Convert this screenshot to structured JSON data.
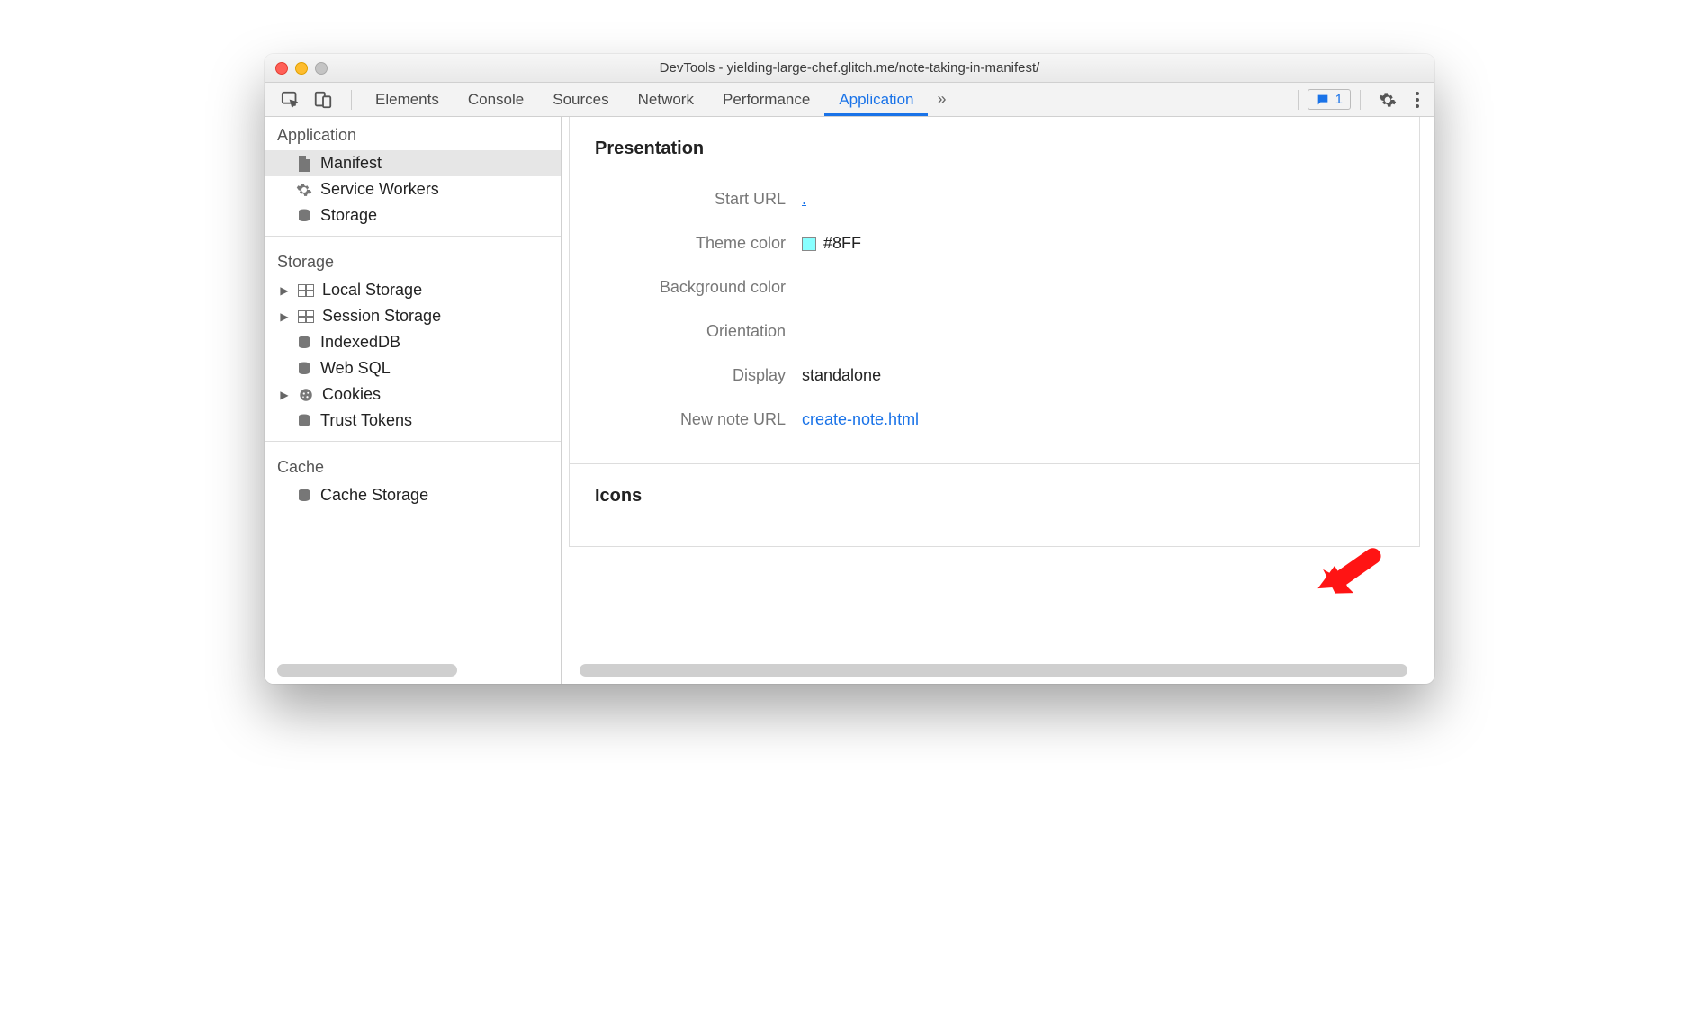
{
  "titlebar": {
    "title": "DevTools - yielding-large-chef.glitch.me/note-taking-in-manifest/"
  },
  "tabs": {
    "elements": "Elements",
    "console": "Console",
    "sources": "Sources",
    "network": "Network",
    "performance": "Performance",
    "application": "Application",
    "badge_count": "1"
  },
  "sidebar": {
    "groups": [
      {
        "title": "Application",
        "items": [
          {
            "label": "Manifest",
            "icon": "file",
            "selected": true
          },
          {
            "label": "Service Workers",
            "icon": "gear"
          },
          {
            "label": "Storage",
            "icon": "db"
          }
        ]
      },
      {
        "title": "Storage",
        "items": [
          {
            "label": "Local Storage",
            "icon": "table",
            "expandable": true
          },
          {
            "label": "Session Storage",
            "icon": "table",
            "expandable": true
          },
          {
            "label": "IndexedDB",
            "icon": "db"
          },
          {
            "label": "Web SQL",
            "icon": "db"
          },
          {
            "label": "Cookies",
            "icon": "cookie",
            "expandable": true
          },
          {
            "label": "Trust Tokens",
            "icon": "db"
          }
        ]
      },
      {
        "title": "Cache",
        "items": [
          {
            "label": "Cache Storage",
            "icon": "db"
          }
        ]
      }
    ]
  },
  "main": {
    "presentation": {
      "title": "Presentation",
      "start_url_label": "Start URL",
      "start_url_value": ".",
      "theme_color_label": "Theme color",
      "theme_color_value": "#8FF",
      "background_color_label": "Background color",
      "orientation_label": "Orientation",
      "display_label": "Display",
      "display_value": "standalone",
      "new_note_url_label": "New note URL",
      "new_note_url_value": "create-note.html"
    },
    "icons": {
      "title": "Icons"
    }
  }
}
